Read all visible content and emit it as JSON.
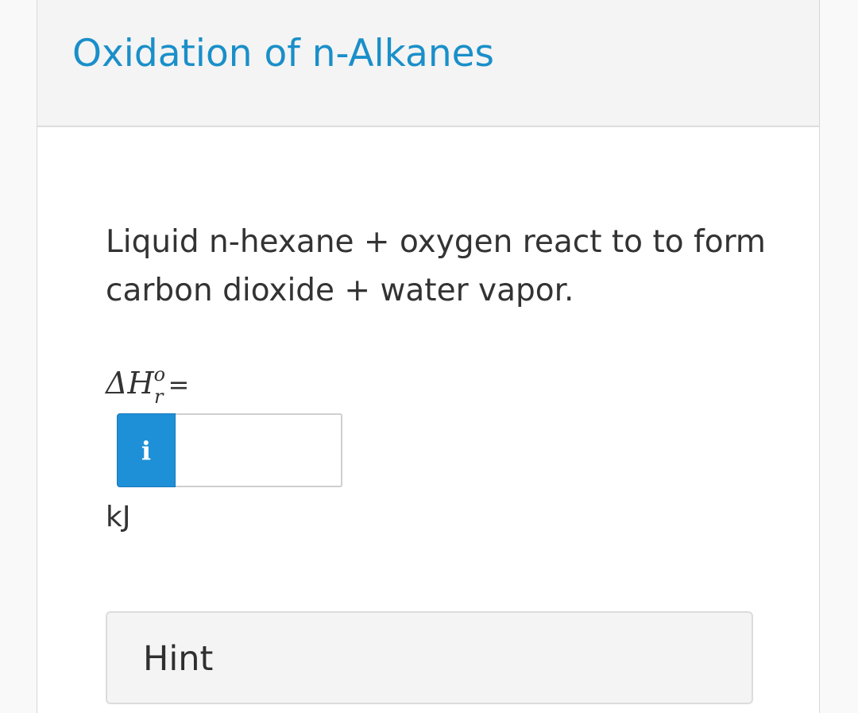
{
  "header": {
    "title": "Oxidation of n-Alkanes"
  },
  "question": {
    "text": "Liquid n-hexane + oxygen react to to form carbon dioxide + water vapor."
  },
  "equation": {
    "delta": "Δ",
    "h": "H",
    "superscript": "o",
    "subscript": "r",
    "equals": "="
  },
  "answer": {
    "info_icon": "info-icon",
    "info_glyph": "i",
    "value": "",
    "placeholder": "",
    "unit": "kJ"
  },
  "hint": {
    "label": "Hint"
  },
  "colors": {
    "title": "#1a8fc9",
    "info_button": "#1e90d8",
    "header_bg": "#f4f4f4",
    "text": "#333333"
  }
}
